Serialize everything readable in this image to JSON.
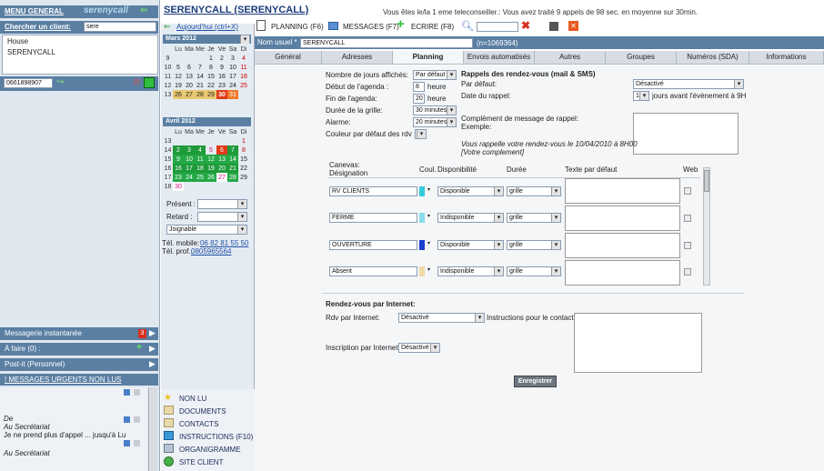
{
  "left": {
    "menu_general": "MENU GENERAL",
    "logo": "serenycall",
    "search_label": "Chercher un client:",
    "search_value": "sere",
    "results": [
      "House",
      "SERENYCALL"
    ],
    "phone_value": "0661898907",
    "panels": {
      "messagerie": "Messagerie instantanée",
      "messagerie_badge": "3",
      "a_faire": "À faire (0) :",
      "post_it": "Post-it (Personnel)",
      "urgents": "! MESSAGES URGENTS NON LUS"
    },
    "messages": [
      {
        "from": "De",
        "to": "Au Secrétariat",
        "text": "Je ne prend plus d'appel ... jusqu'à Lu"
      },
      {
        "to": "Au Secrétariat"
      }
    ]
  },
  "calendar": {
    "today_link": "Aujourd'hui (ctrl+X)",
    "month1": "Mars 2012",
    "month2": "Avril 2012",
    "day_headers": [
      "Lu",
      "Ma",
      "Me",
      "Je",
      "Ve",
      "Sa",
      "Di"
    ],
    "present_label": "Présent :",
    "retard_label": "Retard :",
    "joignable": "Joignable",
    "tel_mobile_label": "Tél. mobile:",
    "tel_mobile": "06 82 81 55 50",
    "tel_pro_label": "Tél. prof.:",
    "tel_pro": "0805965564",
    "menu": [
      {
        "icon": "star-icon",
        "label": "NON LU"
      },
      {
        "icon": "documents-icon",
        "label": "DOCUMENTS"
      },
      {
        "icon": "contacts-icon",
        "label": "CONTACTS"
      },
      {
        "icon": "instructions-icon",
        "label": "INSTRUCTIONS (F10)"
      },
      {
        "icon": "organigram-icon",
        "label": "ORGANIGRAMME"
      },
      {
        "icon": "globe-icon",
        "label": "SITE CLIENT"
      }
    ]
  },
  "header": {
    "client_title": "SERENYCALL (SERENYCALL)",
    "status": "Vous êtes le/la 1 eme teleconseiller.: Vous avez traité 9 appels de 98 sec. en moyenne sur 30min.",
    "planning": "PLANNING (F6)",
    "messages": "MESSAGES (F7)",
    "ecrire": "ECRIRE (F8)",
    "nom_usuel_label": "Nom usuel *",
    "nom_usuel_value": "SERENYCALL",
    "client_number": "(n=1069364)"
  },
  "tabs": [
    "Général",
    "Adresses",
    "Planning",
    "Envois automatisés",
    "Autres",
    "Groupes",
    "Numéros (SDA)",
    "Informations"
  ],
  "form": {
    "nb_jours_label": "Nombre de jours affichés:",
    "nb_jours_value": "Par défaut",
    "debut_label": "Début de l'agenda :",
    "debut_value": "8",
    "fin_label": "Fin de l'agenda:",
    "fin_value": "20",
    "heure": "heure",
    "duree_label": "Durée de la grille:",
    "duree_value": "30 minutes",
    "alarme_label": "Alarme:",
    "alarme_value": "20 minutes",
    "couleur_label": "Couleur par défaut des rdv :",
    "rappels_title": "Rappels des rendez-vous (mail & SMS)",
    "par_defaut_label": "Par défaut:",
    "par_defaut_value": "Désactivé",
    "date_rappel_label": "Date du rappel:",
    "date_rappel_value": "1",
    "date_rappel_suffix": "jours avant l'évènement à 9H",
    "complement_label": "Complément de message de rappel:",
    "exemple_label": "Exemple:",
    "exemple_text1": "Vous rappelle votre rendez-vous le 10/04/2010 à 8H00",
    "exemple_text2": "[Votre complement]",
    "canevas_label": "Canevas:",
    "col_designation": "Désignation",
    "col_coul": "Coul.",
    "col_dispo": "Disponibilité",
    "col_duree": "Durée",
    "col_texte": "Texte par défaut",
    "col_web": "Web",
    "rows": [
      {
        "designation": "RV CLIENTS",
        "color": "#33ccdd",
        "dispo": "Disponible",
        "duree": "grille"
      },
      {
        "designation": "FERME",
        "color": "#88ddee",
        "dispo": "Indisponible",
        "duree": "grille"
      },
      {
        "designation": "OUVERTURE",
        "color": "#1a3fcc",
        "dispo": "Disponible",
        "duree": "grille"
      },
      {
        "designation": "Absent",
        "color": "#f0d8a8",
        "dispo": "Indisponible",
        "duree": "grille"
      }
    ],
    "internet_title": "Rendez-vous par Internet:",
    "rdv_internet_label": "Rdv par Internet:",
    "rdv_internet_value": "Désactivé",
    "instructions_label": "Instructions pour le contact:",
    "inscription_label": "Inscription par Internet:",
    "inscription_value": "Désactivé",
    "save": "Enregistrer"
  }
}
